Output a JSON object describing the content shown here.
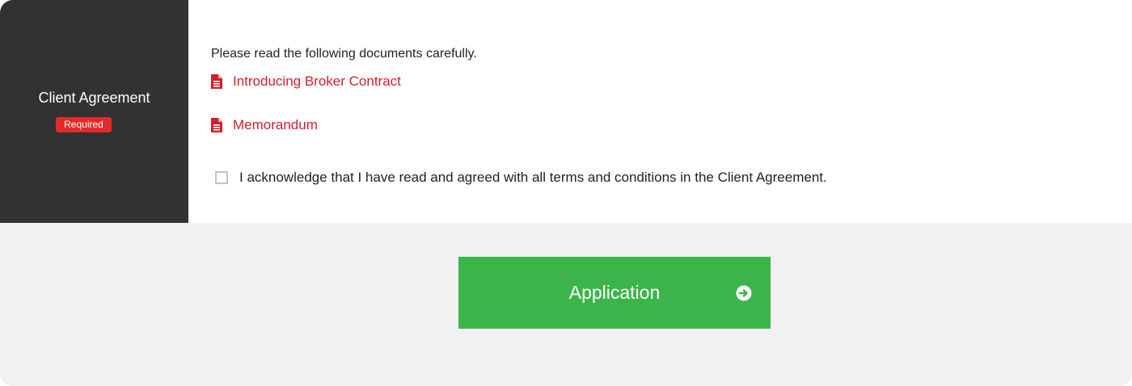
{
  "section": {
    "label": "Client Agreement",
    "badge": "Required"
  },
  "documents": {
    "instruction": "Please read the following documents carefully.",
    "items": [
      {
        "label": "Introducing Broker Contract",
        "icon": "file-document-icon"
      },
      {
        "label": "Memorandum",
        "icon": "file-document-icon"
      }
    ]
  },
  "acknowledgement": {
    "text": "I acknowledge that I have read and agreed with all terms and conditions in the Client Agreement.",
    "checked": false
  },
  "submit": {
    "label": "Application",
    "icon": "arrow-circle-right-icon"
  },
  "colors": {
    "label_bg": "#323232",
    "badge": "#e32b2b",
    "link": "#d0202a",
    "button": "#3bb54a",
    "footer_bg": "#f1f1f1"
  }
}
